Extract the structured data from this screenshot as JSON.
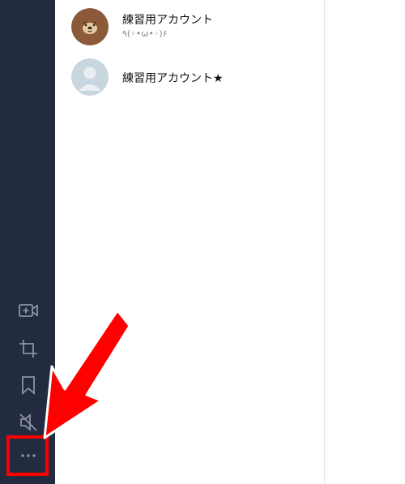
{
  "sidebar": {
    "icons": [
      {
        "name": "video-add-icon"
      },
      {
        "name": "crop-icon"
      },
      {
        "name": "bookmark-icon"
      },
      {
        "name": "mute-icon"
      },
      {
        "name": "more-icon"
      }
    ]
  },
  "friends": [
    {
      "name": "練習用アカウント",
      "status": "٩(◦•ω•◦)۶",
      "avatar": "bear-avatar"
    },
    {
      "name": "練習用アカウント★",
      "status": "",
      "avatar": "default-avatar"
    }
  ],
  "colors": {
    "sidebar_bg": "#222b3f",
    "icon": "#8c93a3",
    "highlight": "#ff0000"
  }
}
